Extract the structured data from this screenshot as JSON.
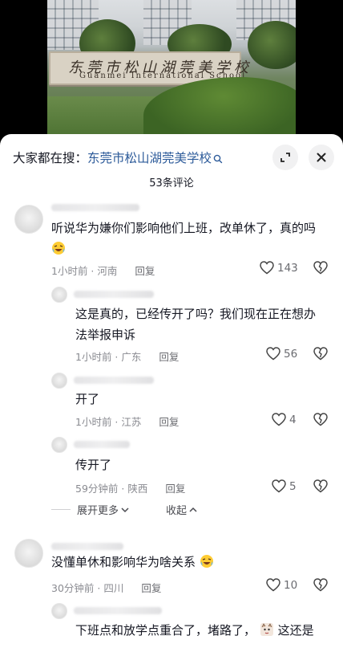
{
  "video": {
    "sign_chinese": "东莞市松山湖莞美学校",
    "sign_english": "Guanmei International School"
  },
  "sheet": {
    "search_prefix": "大家都在搜：",
    "search_term": "东莞市松山湖莞美学校",
    "comment_count": "53条评论"
  },
  "comments": [
    {
      "text": "听说华为嫌你们影响他们上班，改单休了，真的吗",
      "emoji": "crying-laughing-emoji",
      "time": "1小时前 · 河南",
      "reply": "回复",
      "likes": "143"
    },
    {
      "text_line1": "这是真的，已经传开了吗？我们现在正在想办",
      "text_line2": "法举报申诉",
      "time": "1小时前 · 广东",
      "reply": "回复",
      "likes": "56"
    },
    {
      "text": "开了",
      "time": "1小时前 · 江苏",
      "reply": "回复",
      "likes": "4"
    },
    {
      "text": "传开了",
      "time": "59分钟前 · 陕西",
      "reply": "回复",
      "likes": "5"
    },
    {
      "text": "没懂单休和影响华为啥关系",
      "emoji": "crying-laughing-emoji",
      "time": "30分钟前 · 四川",
      "reply": "回复",
      "likes": "10"
    },
    {
      "text_before": "下班点和放学点重合了，堵路了，",
      "emoji": "cat-face-emoji",
      "text_after": "这还是"
    }
  ],
  "replies_toggle": {
    "expand_label": "展开更多",
    "collapse_label": "收起"
  },
  "colors": {
    "link": "#2d5b9a",
    "text": "#161823",
    "meta": "#8a8b91",
    "button_bg": "#f1f1f2"
  }
}
